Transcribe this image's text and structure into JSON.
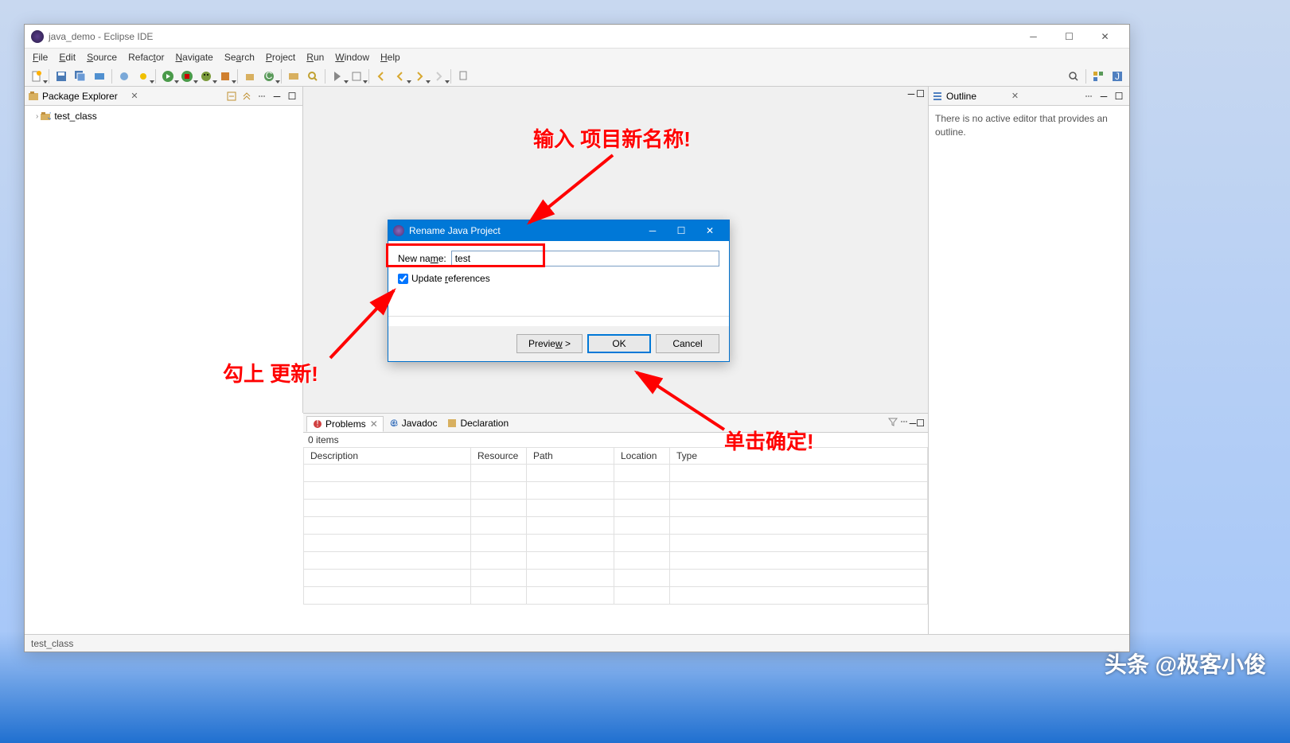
{
  "window": {
    "title": "java_demo - Eclipse IDE"
  },
  "menu": {
    "file": "File",
    "edit": "Edit",
    "source": "Source",
    "refactor": "Refactor",
    "navigate": "Navigate",
    "search": "Search",
    "project": "Project",
    "run": "Run",
    "window": "Window",
    "help": "Help"
  },
  "package_explorer": {
    "title": "Package Explorer",
    "tree_item": "test_class"
  },
  "outline": {
    "title": "Outline",
    "message": "There is no active editor that provides an outline."
  },
  "problems": {
    "tab_problems": "Problems",
    "tab_javadoc": "Javadoc",
    "tab_declaration": "Declaration",
    "items": "0 items",
    "cols": {
      "description": "Description",
      "resource": "Resource",
      "path": "Path",
      "location": "Location",
      "type": "Type"
    }
  },
  "dialog": {
    "title": "Rename Java Project",
    "newname_label": "New name:",
    "newname_value": "test",
    "update_refs": "Update references",
    "preview": "Preview >",
    "ok": "OK",
    "cancel": "Cancel"
  },
  "status": {
    "text": "test_class"
  },
  "annotations": {
    "input_new_name": "输入 项目新名称!",
    "check_update": "勾上 更新!",
    "click_ok": "单击确定!"
  },
  "watermark": "头条 @极客小俊"
}
